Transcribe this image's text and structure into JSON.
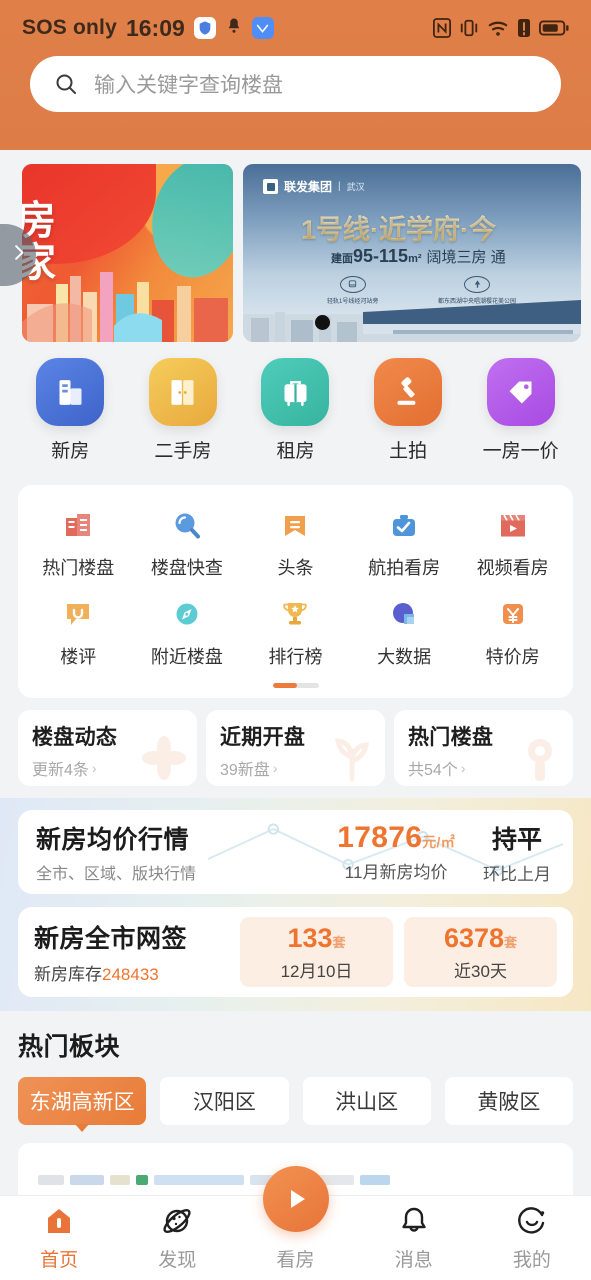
{
  "status_bar": {
    "carrier": "SOS only",
    "time": "16:09",
    "icons": [
      "shield-icon",
      "bell-icon",
      "app-badge-icon",
      "nfc-icon",
      "vibrate-icon",
      "wifi-icon",
      "alert-icon",
      "battery-icon"
    ]
  },
  "search": {
    "placeholder": "输入关键字查询楼盘",
    "icon": "search-icon"
  },
  "banners": {
    "prev_arrow": "chevron-right-icon",
    "items": [
      {
        "id": "b1",
        "line1": "房",
        "line2": "家"
      },
      {
        "id": "b2",
        "brand": "联发集团",
        "separator": "|",
        "city": "武汉",
        "headline": "1号线·近学府·今",
        "sub_prefix": "建面",
        "sub_size": "95-115",
        "sub_unit": "m²",
        "sub_rest": "阔境三房 通",
        "feature1": "轻轨1号线经河站旁",
        "feature2": "都东西湖中央唱潮樱花美公园"
      }
    ]
  },
  "nav_main": [
    {
      "label": "新房",
      "icon": "building-icon",
      "color": "#4a6fd4"
    },
    {
      "label": "二手房",
      "icon": "door-icon",
      "color": "#eeb944"
    },
    {
      "label": "租房",
      "icon": "suitcase-icon",
      "color": "#44c1ad"
    },
    {
      "label": "土拍",
      "icon": "gavel-icon",
      "color": "#e87c3e"
    },
    {
      "label": "一房一价",
      "icon": "tag-icon",
      "color": "#b55fe9"
    }
  ],
  "grid": {
    "row1": [
      {
        "label": "热门楼盘",
        "icon": "hot-building-icon"
      },
      {
        "label": "楼盘快查",
        "icon": "magnifier-icon"
      },
      {
        "label": "头条",
        "icon": "headline-icon"
      },
      {
        "label": "航拍看房",
        "icon": "drone-camera-icon"
      },
      {
        "label": "视频看房",
        "icon": "video-clapper-icon"
      }
    ],
    "row2": [
      {
        "label": "楼评",
        "icon": "comment-icon"
      },
      {
        "label": "附近楼盘",
        "icon": "compass-icon"
      },
      {
        "label": "排行榜",
        "icon": "trophy-icon"
      },
      {
        "label": "大数据",
        "icon": "pie-chart-icon"
      },
      {
        "label": "特价房",
        "icon": "yuan-tag-icon"
      }
    ],
    "page_indicator": "page-dots"
  },
  "triple_cards": [
    {
      "title": "楼盘动态",
      "sub": "更新4条",
      "chevron": "›",
      "deco": "flower-icon"
    },
    {
      "title": "近期开盘",
      "sub": "39新盘",
      "chevron": "›",
      "deco": "plant-icon"
    },
    {
      "title": "热门楼盘",
      "sub": "共54个",
      "chevron": "›",
      "deco": "key-icon"
    }
  ],
  "price_card": {
    "title": "新房均价行情",
    "subtitle": "全市、区域、版块行情",
    "price": "17876",
    "price_unit": "元/㎡",
    "price_label": "11月新房均价",
    "trend": "持平",
    "trend_label": "环比上月"
  },
  "signing_card": {
    "title": "新房全市网签",
    "stock_label": "新房库存",
    "stock_value": "248433",
    "boxes": [
      {
        "value": "133",
        "unit": "套",
        "label": "12月10日"
      },
      {
        "value": "6378",
        "unit": "套",
        "label": "近30天"
      }
    ]
  },
  "hot_districts": {
    "title": "热门板块",
    "chips": [
      "东湖高新区",
      "汉阳区",
      "洪山区",
      "黄陂区"
    ],
    "active_index": 0
  },
  "tabbar": [
    {
      "label": "首页",
      "icon": "home-icon",
      "active": true
    },
    {
      "label": "发现",
      "icon": "planet-icon",
      "active": false
    },
    {
      "label": "看房",
      "icon": "play-icon",
      "active": false,
      "center": true
    },
    {
      "label": "消息",
      "icon": "bell-icon",
      "active": false
    },
    {
      "label": "我的",
      "icon": "smiley-icon",
      "active": false
    }
  ],
  "colors": {
    "brand_orange": "#e0804a",
    "accent_orange": "#ee7430",
    "page_bg": "#f2f3f5"
  }
}
